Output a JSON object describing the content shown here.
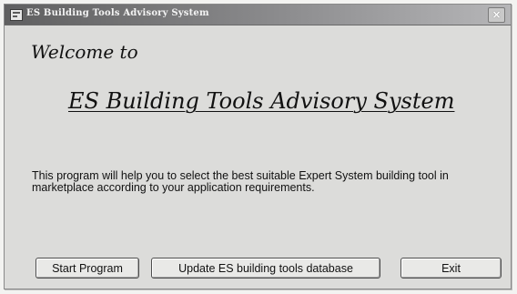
{
  "window": {
    "title": "ES Building Tools Advisory System",
    "close_label": "×"
  },
  "content": {
    "welcome": "Welcome to",
    "app_title": "ES Building Tools Advisory System",
    "description": "This program will help you to select the best suitable Expert System building tool in marketplace according to your application requirements."
  },
  "buttons": {
    "start_label": "Start Program",
    "update_label": "Update ES building tools database",
    "exit_label": "Exit"
  },
  "icons": {
    "window_icon": "app-window-icon",
    "close_icon": "close-icon"
  }
}
